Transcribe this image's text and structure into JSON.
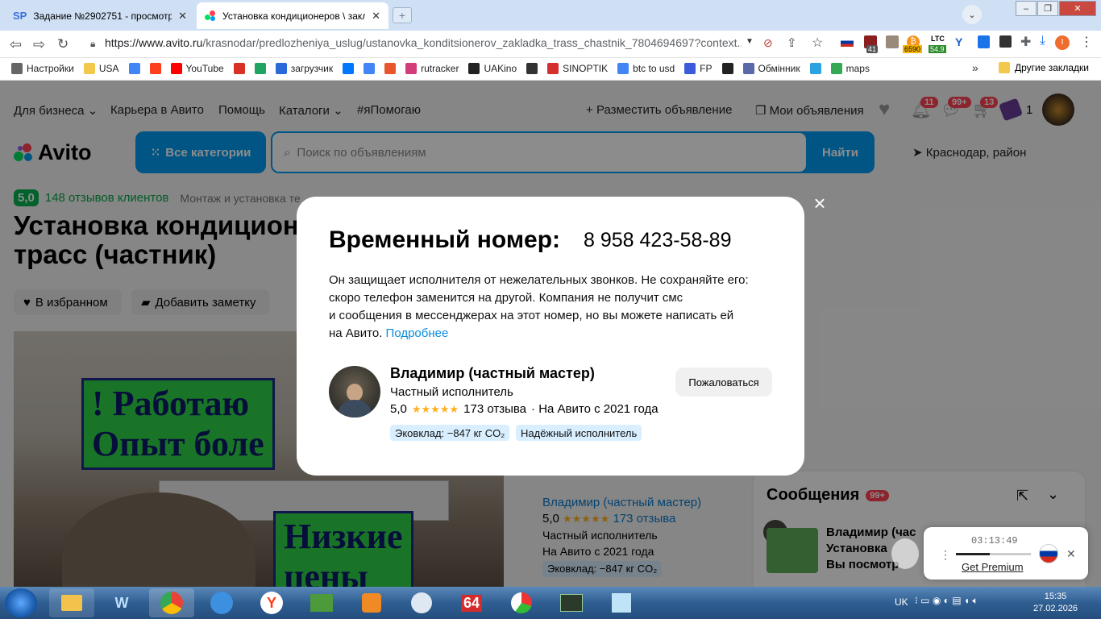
{
  "browser": {
    "tabs": [
      {
        "label": "Задание №2902751 - просмотр з",
        "icon": "sp-icon"
      },
      {
        "label": "Установка кондиционеров \\ закл",
        "icon": "avito-icon"
      }
    ],
    "url_main": "https://www.avito.ru",
    "url_rest": "/krasnodar/predlozheniya_uslug/ustanovka_konditsionerov_zakladka_trass_chastnik_7804694697?context...",
    "extensions": {
      "count_41": "41",
      "price_btc": "6590",
      "ltc_label": "LTC",
      "ltc_value": "54.9"
    },
    "bookmarks": [
      {
        "label": "Настройки",
        "icon": "gear-icon",
        "color": "#666666"
      },
      {
        "label": "USA",
        "icon": "folder-icon",
        "color": "#f2c94c"
      },
      {
        "label": "",
        "icon": "google-icon",
        "color": "#4285f4"
      },
      {
        "label": "",
        "icon": "yandex-icon",
        "color": "#fc3f1d"
      },
      {
        "label": "YouTube",
        "icon": "youtube-icon",
        "color": "#ff0000"
      },
      {
        "label": "",
        "icon": "gmail-icon",
        "color": "#d93025"
      },
      {
        "label": "",
        "icon": "drive-icon",
        "color": "#1fa463"
      },
      {
        "label": "загрузчик",
        "icon": "loader-icon",
        "color": "#2a6ad8"
      },
      {
        "label": "",
        "icon": "vk-icon",
        "color": "#0077ff"
      },
      {
        "label": "",
        "icon": "translate-icon",
        "color": "#4285f4"
      },
      {
        "label": "",
        "icon": "f-icon",
        "color": "#e8572b"
      },
      {
        "label": "rutracker",
        "icon": "rutracker-icon",
        "color": "#d23c7a"
      },
      {
        "label": "UAKino",
        "icon": "uakino-icon",
        "color": "#222222"
      },
      {
        "label": "",
        "icon": "pawn-icon",
        "color": "#333333"
      },
      {
        "label": "SINOPTIK",
        "icon": "thermometer-icon",
        "color": "#d32f2f"
      },
      {
        "label": "btc to usd",
        "icon": "google-icon",
        "color": "#4285f4"
      },
      {
        "label": "FP",
        "icon": "fp-icon",
        "color": "#3b5bdb"
      },
      {
        "label": "",
        "icon": "bc-icon",
        "color": "#222222"
      },
      {
        "label": "Обмінник",
        "icon": "exchange-icon",
        "color": "#5a6aa8"
      },
      {
        "label": "",
        "icon": "star-burst-icon",
        "color": "#2aa3e0"
      },
      {
        "label": "maps",
        "icon": "maps-icon",
        "color": "#34a853"
      }
    ],
    "more": "»",
    "other_bookmarks": "Другие закладки"
  },
  "avito": {
    "topnav": [
      "Для бизнеса",
      "Карьера в Авито",
      "Помощь",
      "Каталоги",
      "#яПомогаю"
    ],
    "post_ad": "Разместить объявление",
    "my_ads": "Мои объявления",
    "badges": {
      "notifications": "11",
      "messages": "99+",
      "cart": "13",
      "wallet": "1"
    },
    "logo": "Avito",
    "all_categories": "Все категории",
    "search_placeholder": "Поиск по объявлениям",
    "find": "Найти",
    "location": "Краснодар, район",
    "rating_score": "5,0",
    "reviews": "148 отзывов клиентов",
    "category": "Монтаж и установка те",
    "title": "Установка кондиционеров закладка трасс (частник)",
    "title_line1": "Установка кондицион",
    "title_line2": "трасс (частник)",
    "fav": "В избранном",
    "note": "Добавить заметку",
    "photo_sign1": "! Работаю",
    "photo_sign2": "Опыт боле",
    "photo_sign3": "Низкие",
    "photo_sign4": "цены",
    "seller_card": {
      "name": "Владимир (частный мастер)",
      "score": "5,0",
      "reviews": "173 отзыва",
      "type": "Частный исполнитель",
      "since": "На Авито с 2021 года",
      "eco": "Эковклад: −847 кг CO₂"
    },
    "messages": {
      "title": "Сообщения",
      "badge": "99+",
      "item_name": "Владимир (час",
      "item_title": "Установка",
      "item_status": "Вы посмотр"
    }
  },
  "modal": {
    "title": "Временный номер:",
    "phone": "8 958 423-58-89",
    "text": "Он защищает исполнителя от нежелательных звонков. Не сохраняйте его: скоро телефон заменится на другой. Компания не получит смс и сообщения в мессенджерах на этот номер, но вы можете написать ей на Авито.",
    "text_l1": "Он защищает исполнителя от нежелательных звонков. Не сохраняйте его:",
    "text_l2": "скоро телефон заменится на другой. Компания не получит смс",
    "text_l3": "и сообщения в мессенджерах на этот номер, но вы можете написать ей",
    "text_l4": "на Авито.",
    "more_link": "Подробнее",
    "seller_name": "Владимир (частный мастер)",
    "seller_type": "Частный исполнитель",
    "score": "5,0",
    "stars": "★★★★★",
    "reviews": "173 отзыва",
    "since": "· На Авито с 2021 года",
    "chip_eco": "Эковклад: −847 кг CO₂",
    "chip_reliable": "Надёжный исполнитель",
    "complain": "Пожаловаться",
    "close": "×"
  },
  "player": {
    "time": "03:13:49",
    "progress": 0.45,
    "premium": "Get Premium"
  },
  "taskbar": {
    "lang": "UK",
    "time": "15:35",
    "date": "27.02.2026",
    "chrome_64": "64"
  },
  "colors": {
    "avito_blue": "#009cf0",
    "avito_green": "#04b34f",
    "badge_red": "#ff4053",
    "chip_blue": "#d9efff"
  }
}
